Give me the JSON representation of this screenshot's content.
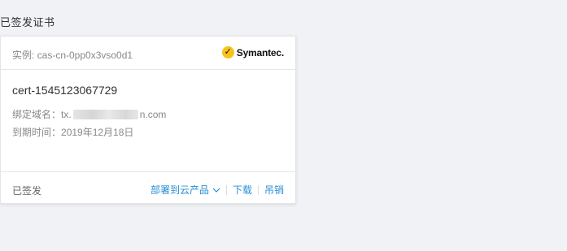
{
  "section": {
    "title": "已签发证书"
  },
  "card": {
    "instance_label": "实例: cas-cn-0pp0x3vso0d1",
    "brand": {
      "mark": "✓",
      "name": "Symantec."
    },
    "cert_name": "cert-1545123067729",
    "domain": {
      "label": "绑定域名：",
      "prefix": "tx.",
      "suffix": "n.com"
    },
    "expire": {
      "label": "到期时间：",
      "value": "2019年12月18日"
    },
    "status": "已签发",
    "actions": {
      "deploy": "部署到云产品",
      "download": "下载",
      "revoke": "吊销"
    }
  },
  "colors": {
    "link": "#2a8fd5",
    "brand_yellow": "#f8c21a",
    "background": "#f1f2f5"
  }
}
